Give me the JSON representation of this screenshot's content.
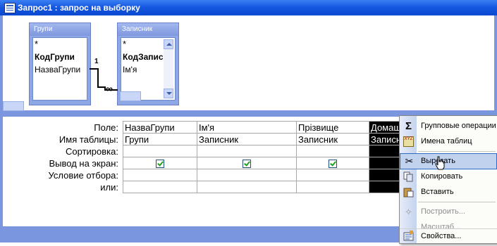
{
  "window": {
    "title": "Запрос1 : запрос на выборку"
  },
  "tables": [
    {
      "name": "Групи",
      "fields": [
        "*",
        "КодГрупи",
        "НазваГрупи"
      ]
    },
    {
      "name": "Записник",
      "fields": [
        "*",
        "КодЗаписи",
        "Ім'я"
      ]
    }
  ],
  "relationship": {
    "one": "1",
    "many": "∞"
  },
  "grid": {
    "row_labels": [
      "Поле:",
      "Имя таблицы:",
      "Сортировка:",
      "Вывод на экран:",
      "Условие отбора:",
      "или:"
    ],
    "columns": [
      {
        "field": "НазваГрупи",
        "table": "Групи",
        "show": true
      },
      {
        "field": "Ім'я",
        "table": "Записник",
        "show": true
      },
      {
        "field": "Прізвище",
        "table": "Записник",
        "show": true
      },
      {
        "field": "Домаш",
        "table": "Записн",
        "show": false
      }
    ]
  },
  "context_menu": {
    "items": [
      {
        "label": "Групповые операции",
        "icon": "sigma-icon",
        "disabled": false
      },
      {
        "label": "Имена таблиц",
        "icon": "table-names-icon",
        "disabled": false
      },
      {
        "label": "Вырезать",
        "icon": "scissors-icon",
        "disabled": false,
        "highlighted": true
      },
      {
        "label": "Копировать",
        "icon": "copy-icon",
        "disabled": false
      },
      {
        "label": "Вставить",
        "icon": "paste-icon",
        "disabled": false
      },
      {
        "label": "Построить...",
        "icon": "build-icon",
        "disabled": true
      },
      {
        "label": "Масштаб...",
        "icon": "",
        "disabled": true
      },
      {
        "label": "Свойства...",
        "icon": "properties-icon",
        "disabled": false
      }
    ]
  },
  "colors": {
    "title_bar": "#0a48d0",
    "frame": "#7a96df",
    "menu_highlight": "#c1d2ee"
  }
}
